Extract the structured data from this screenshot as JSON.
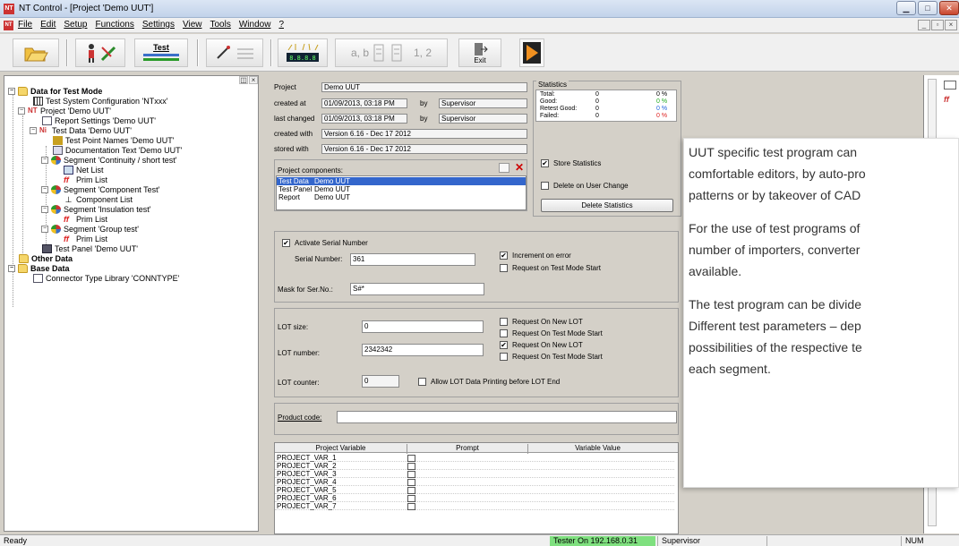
{
  "window": {
    "title": "NT Control - [Project 'Demo UUT']",
    "app_icon": "NT",
    "buttons": [
      "minimize-icon",
      "maximize-icon",
      "close-icon"
    ]
  },
  "menubar": {
    "items": [
      "File",
      "Edit",
      "Setup",
      "Functions",
      "Settings",
      "View",
      "Tools",
      "Window",
      "?"
    ]
  },
  "toolbar": {
    "test_label": "Test",
    "seg_label": "a, b",
    "num_label": "1, 2",
    "exit_label": "Exit"
  },
  "tree": {
    "items": [
      {
        "label": "Data for Test Mode",
        "bold": true
      },
      {
        "label": "Test System Configuration 'NTxxx'"
      },
      {
        "label": "Project 'Demo UUT'"
      },
      {
        "label": "Report Settings 'Demo UUT'"
      },
      {
        "label": "Test Data 'Demo UUT'"
      },
      {
        "label": "Test Point Names 'Demo UUT'"
      },
      {
        "label": "Documentation Text 'Demo UUT'"
      },
      {
        "label": "Segment 'Continuity / short test'"
      },
      {
        "label": "Net List"
      },
      {
        "label": "Prim List"
      },
      {
        "label": "Segment 'Component Test'"
      },
      {
        "label": "Component List"
      },
      {
        "label": "Segment 'Insulation test'"
      },
      {
        "label": "Prim List"
      },
      {
        "label": "Segment 'Group test'"
      },
      {
        "label": "Prim List"
      },
      {
        "label": "Test Panel 'Demo UUT'"
      },
      {
        "label": "Other Data",
        "bold": true
      },
      {
        "label": "Base Data",
        "bold": true
      },
      {
        "label": "Connector Type Library 'CONNTYPE'"
      }
    ]
  },
  "project": {
    "project_label": "Project",
    "project_value": "Demo UUT",
    "created_at_label": "created at",
    "created_at_value": "01/09/2013, 03:18 PM",
    "by_label": "by",
    "created_by": "Supervisor",
    "last_changed_label": "last changed",
    "last_changed_value": "01/09/2013, 03:18 PM",
    "changed_by": "Supervisor",
    "created_with_label": "created with",
    "created_with_value": "Version 6.16 - Dec 17 2012",
    "stored_with_label": "stored with",
    "stored_with_value": "Version 6.16 - Dec 17 2012"
  },
  "statistics": {
    "title": "Statistics",
    "rows": [
      {
        "label": "Total:",
        "count": "0",
        "pct": "0 %",
        "color": "#000000"
      },
      {
        "label": "Good:",
        "count": "0",
        "pct": "0 %",
        "color": "#22aa22"
      },
      {
        "label": "Retest Good:",
        "count": "0",
        "pct": "0 %",
        "color": "#2266dd"
      },
      {
        "label": "Failed:",
        "count": "0",
        "pct": "0 %",
        "color": "#dd2222"
      }
    ],
    "store_label": "Store Statistics",
    "store_checked": "✔",
    "delete_on_change_label": "Delete on User Change",
    "delete_button": "Delete Statistics"
  },
  "components": {
    "title": "Project components:",
    "rows": [
      {
        "name": "Test Data",
        "value": "Demo UUT"
      },
      {
        "name": "Test Panel",
        "value": "Demo UUT"
      },
      {
        "name": "Report",
        "value": "Demo UUT"
      }
    ]
  },
  "serial": {
    "activate_label": "Activate Serial Number",
    "activate_checked": "✔",
    "serial_label": "Serial Number:",
    "serial_value": "361",
    "increment_label": "Increment on error",
    "increment_checked": "✔",
    "request_label": "Request on Test Mode Start",
    "mask_label": "Mask for Ser.No.:",
    "mask_value": "S#*"
  },
  "lot": {
    "size_label": "LOT size:",
    "size_value": "0",
    "size_req_new": "Request On New LOT",
    "size_req_start": "Request On Test Mode Start",
    "number_label": "LOT number:",
    "number_value": "2342342",
    "number_req_new": "Request On New LOT",
    "number_req_new_checked": "✔",
    "number_req_start": "Request On Test Mode Start",
    "counter_label": "LOT counter:",
    "counter_value": "0",
    "allow_label": "Allow LOT Data Printing before LOT End"
  },
  "product": {
    "label": "Product code:",
    "value": ""
  },
  "variables": {
    "headers": [
      "Project Variable",
      "Prompt",
      "Variable Value"
    ],
    "rows": [
      "PROJECT_VAR_1",
      "PROJECT_VAR_2",
      "PROJECT_VAR_3",
      "PROJECT_VAR_4",
      "PROJECT_VAR_5",
      "PROJECT_VAR_6",
      "PROJECT_VAR_7"
    ]
  },
  "overlay": {
    "lines": [
      "UUT specific test program can",
      "comfortable editors, by auto-pro",
      "patterns or by takeover of CAD",
      "For the use of test programs of",
      "number of importers, converter",
      "available.",
      "The test program can be divide",
      "Different test parameters – dep",
      "possibilities of the respective te",
      "each segment."
    ]
  },
  "status": {
    "ready": "Ready",
    "tester": "Tester On 192.168.0.31",
    "tester_color": "#7fe07f",
    "user": "Supervisor",
    "num": "NUM"
  }
}
